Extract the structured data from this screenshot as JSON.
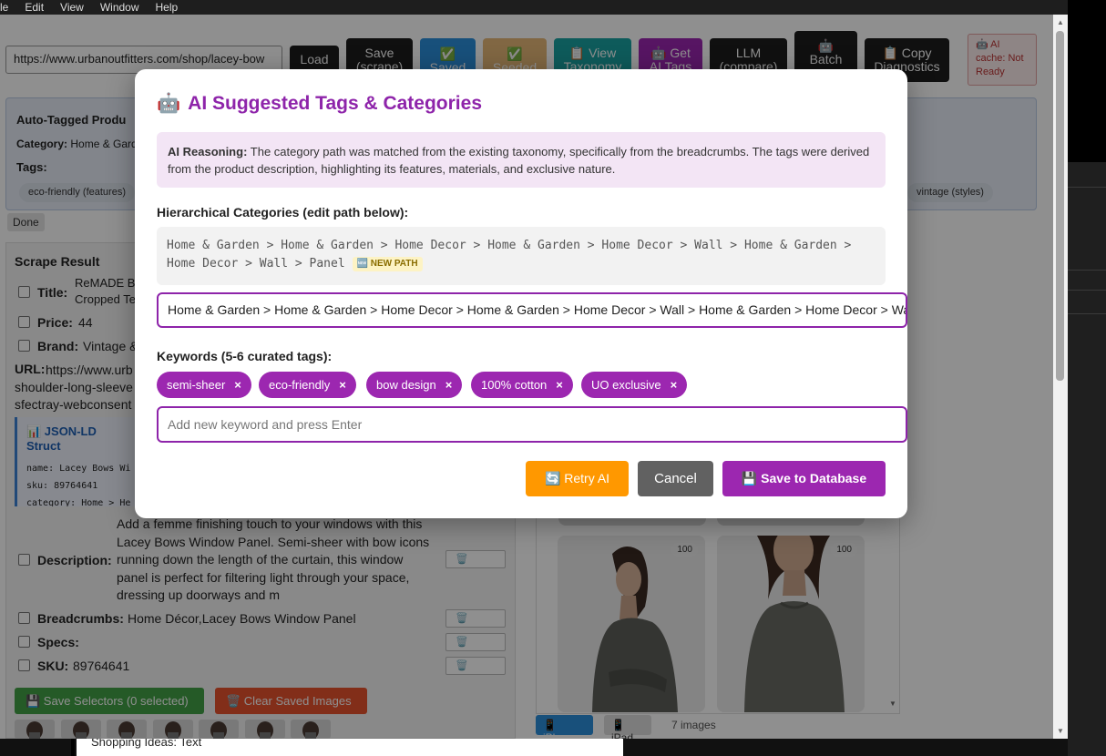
{
  "menu": [
    "le",
    "Edit",
    "View",
    "Window",
    "Help"
  ],
  "toolbar": {
    "url_value": "https://www.urbanoutfitters.com/shop/lacey-bow",
    "load": "Load",
    "save": "Save\n(scrape)",
    "saved": "✅\nSaved",
    "seeded": "✅\nSeeded",
    "view_taxonomy": "📋 View\nTaxonomy",
    "get_ai_tags": "🤖 Get\nAI Tags",
    "llm_compare": "LLM\n(compare)",
    "batch": "🤖\nBatch",
    "copy_diagnostics": "📋 Copy\nDiagnostics",
    "ai_cache": "🤖 AI\ncache: Not\nReady"
  },
  "autotag": {
    "title": "Auto-Tagged Produ",
    "category_label": "Category:",
    "category_value": "Home & Gard",
    "tags_label": "Tags:",
    "chip_left": "eco-friendly (features)",
    "chip_right": "vintage (styles)"
  },
  "status": "Done",
  "scrape": {
    "title": "Scrape Result",
    "title_label": "Title:",
    "title_value": "ReMADE B\nCropped Te",
    "price_label": "Price:",
    "price_value": "44",
    "brand_label": "Brand:",
    "brand_value": "Vintage &",
    "url_label": "URL:",
    "url_value": "https://www.urb\nshoulder-long-sleeve\nsfectray-webconsent",
    "json_title": "📊 JSON-LD Struct",
    "json_name": "name: Lacey Bows Wi",
    "json_sku": "sku: 89764641",
    "json_category": "category: Home > He",
    "desc_label": "Description:",
    "desc_value": "Add a femme finishing touch to your windows with this Lacey Bows Window Panel. Semi-sheer with bow icons running down the length of the curtain, this window panel is perfect for filtering light through your space, dressing up doorways and m",
    "bread_label": "Breadcrumbs:",
    "bread_value": "Home Décor,Lacey Bows Window Panel",
    "specs_label": "Specs:",
    "sku_label": "SKU:",
    "sku_value": "89764641",
    "save_selectors": "💾 Save Selectors (0 selected)",
    "clear_images": "🗑️ Clear Saved Images",
    "trash": "🗑️"
  },
  "gallery": {
    "badge": "100",
    "iphone": "📱 iPhone",
    "ipad": "📱 iPad",
    "count": "7 images"
  },
  "bottom_text": "Shopping Ideas: Text",
  "modal": {
    "icon": "🤖",
    "title": "AI Suggested Tags & Categories",
    "reasoning_label": "AI Reasoning:",
    "reasoning_text": " The category path was matched from the existing taxonomy, specifically from the breadcrumbs. The tags were derived from the product description, highlighting its features, materials, and exclusive nature.",
    "hier_label": "Hierarchical Categories (edit path below):",
    "path_display": "Home & Garden > Home & Garden > Home Decor > Home & Garden > Home Decor > Wall > Home & Garden > Home Decor > Wall > Panel",
    "new_path": "🆕 NEW PATH",
    "path_input": "Home & Garden > Home & Garden > Home Decor > Home & Garden > Home Decor > Wall > Home & Garden > Home Decor > Wall > Panel",
    "keywords_label": "Keywords (5-6 curated tags):",
    "tags": [
      "semi-sheer",
      "eco-friendly",
      "bow design",
      "100% cotton",
      "UO exclusive"
    ],
    "tag_remove": "×",
    "keyword_placeholder": "Add new keyword and press Enter",
    "retry": "🔄 Retry AI",
    "cancel": "Cancel",
    "save": "💾 Save to Database"
  },
  "colors": {
    "accent": "#9c27b0",
    "title": "#8e24aa",
    "retry": "#ff9800",
    "cancel": "#616161"
  }
}
